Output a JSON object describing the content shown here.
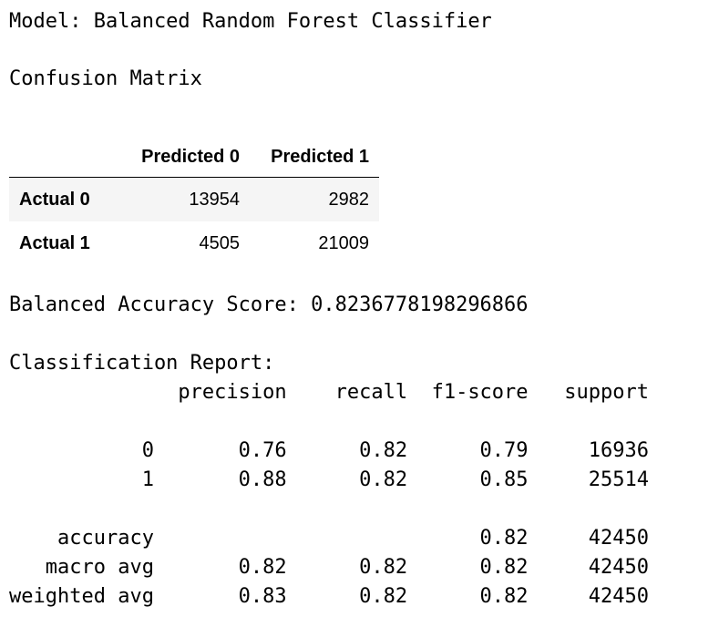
{
  "model_line": "Model: Balanced Random Forest Classifier",
  "confusion_matrix": {
    "title": "Confusion Matrix",
    "columns": [
      "Predicted 0",
      "Predicted 1"
    ],
    "rows": [
      {
        "label": "Actual 0",
        "values": [
          "13954",
          "2982"
        ]
      },
      {
        "label": "Actual 1",
        "values": [
          "4505",
          "21009"
        ]
      }
    ]
  },
  "balanced_accuracy_line": "Balanced Accuracy Score: 0.8236778198296866",
  "classification_report": {
    "lines": [
      "Classification Report:",
      "              precision    recall  f1-score   support",
      "",
      "           0       0.76      0.82      0.79     16936",
      "           1       0.88      0.82      0.85     25514",
      "",
      "    accuracy                           0.82     42450",
      "   macro avg       0.82      0.82      0.82     42450",
      "weighted avg       0.83      0.82      0.82     42450"
    ]
  }
}
